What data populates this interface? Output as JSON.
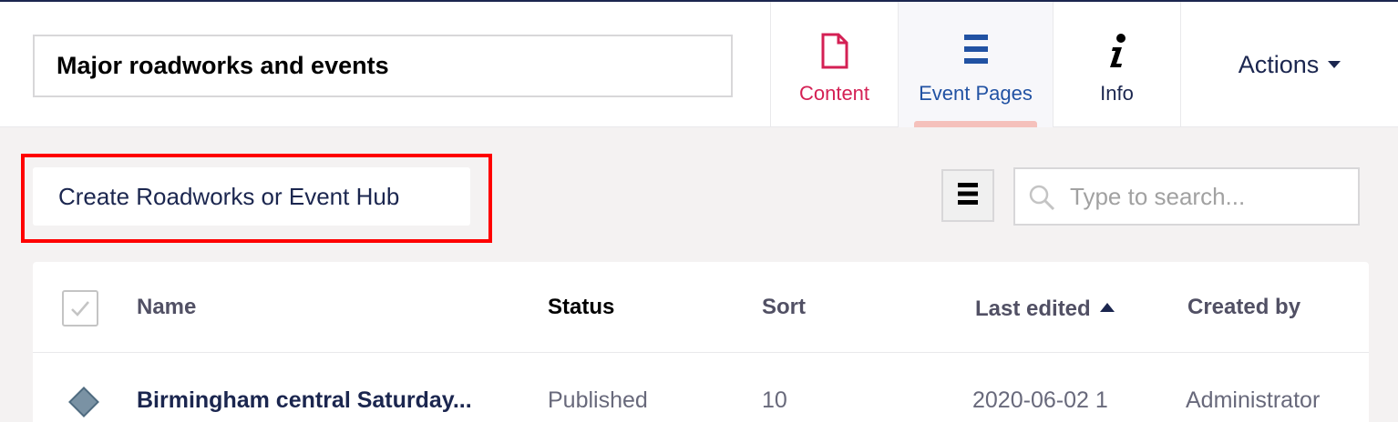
{
  "header": {
    "name_value": "Major roadworks and events",
    "tabs": [
      {
        "label": "Content",
        "icon": "document-icon",
        "color": "#d42054"
      },
      {
        "label": "Event Pages",
        "icon": "list-icon",
        "color": "#2152a3",
        "active": true
      },
      {
        "label": "Info",
        "icon": "info-icon",
        "color": "#1b264f"
      }
    ],
    "actions_label": "Actions"
  },
  "toolbar": {
    "create_label": "Create Roadworks or Event Hub",
    "search_placeholder": "Type to search..."
  },
  "table": {
    "columns": [
      "Name",
      "Status",
      "Sort",
      "Last edited",
      "Created by"
    ],
    "sorted_column": "Last edited",
    "rows": [
      {
        "name": "Birmingham central Saturday...",
        "status": "Published",
        "sort": "10",
        "last_edited": "2020-06-02 1",
        "created_by": "Administrator"
      }
    ]
  }
}
